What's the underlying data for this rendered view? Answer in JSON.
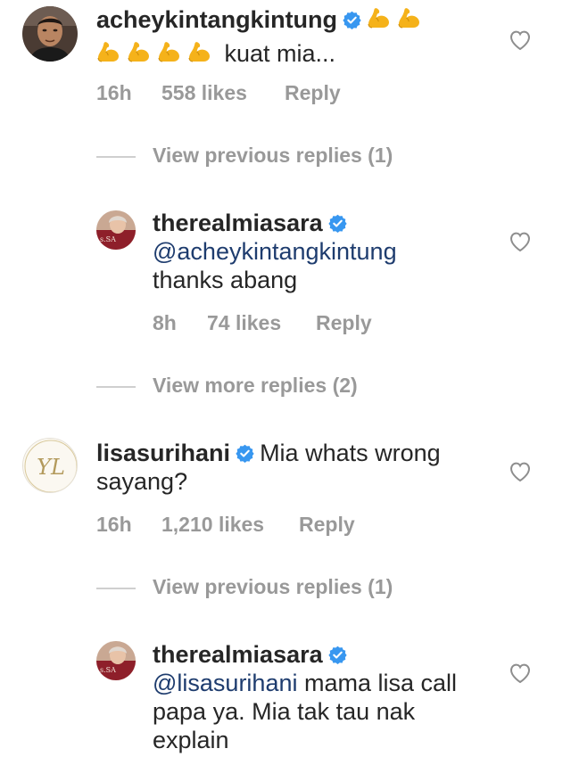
{
  "comments": [
    {
      "username": "acheykintangkintung",
      "verified": true,
      "emoji_count": 6,
      "emoji_name": "flexed-biceps",
      "text": "kuat mia...",
      "time": "16h",
      "likes": "558 likes",
      "reply": "Reply",
      "avatar_icon": "man-portrait"
    },
    {
      "username": "lisasurihani",
      "verified": true,
      "text": "Mia whats wrong sayang?",
      "text_line1": "Mia whats wrong",
      "text_line2": "sayang?",
      "time": "16h",
      "likes": "1,210 likes",
      "reply": "Reply",
      "avatar_icon": "yl-monogram",
      "avatar_text": "YL"
    }
  ],
  "replies": [
    {
      "username": "therealmiasara",
      "verified": true,
      "mention": "@acheykintangkintung",
      "text": "thanks abang",
      "time": "8h",
      "likes": "74 likes",
      "reply": "Reply"
    },
    {
      "username": "therealmiasara",
      "verified": true,
      "mention": "@lisasurihani",
      "text": "mama lisa call papa ya. Mia tak tau nak explain",
      "text_line1": " mama lisa call",
      "text_line2": "papa ya. Mia tak tau nak",
      "text_line3": "explain"
    }
  ],
  "toggles": {
    "first": "View previous replies (1)",
    "second": "View more replies (2)",
    "third": "View previous replies (1)"
  },
  "colors": {
    "verified": "#3897f0",
    "meta": "#999999",
    "mention": "#1e3c6e"
  }
}
